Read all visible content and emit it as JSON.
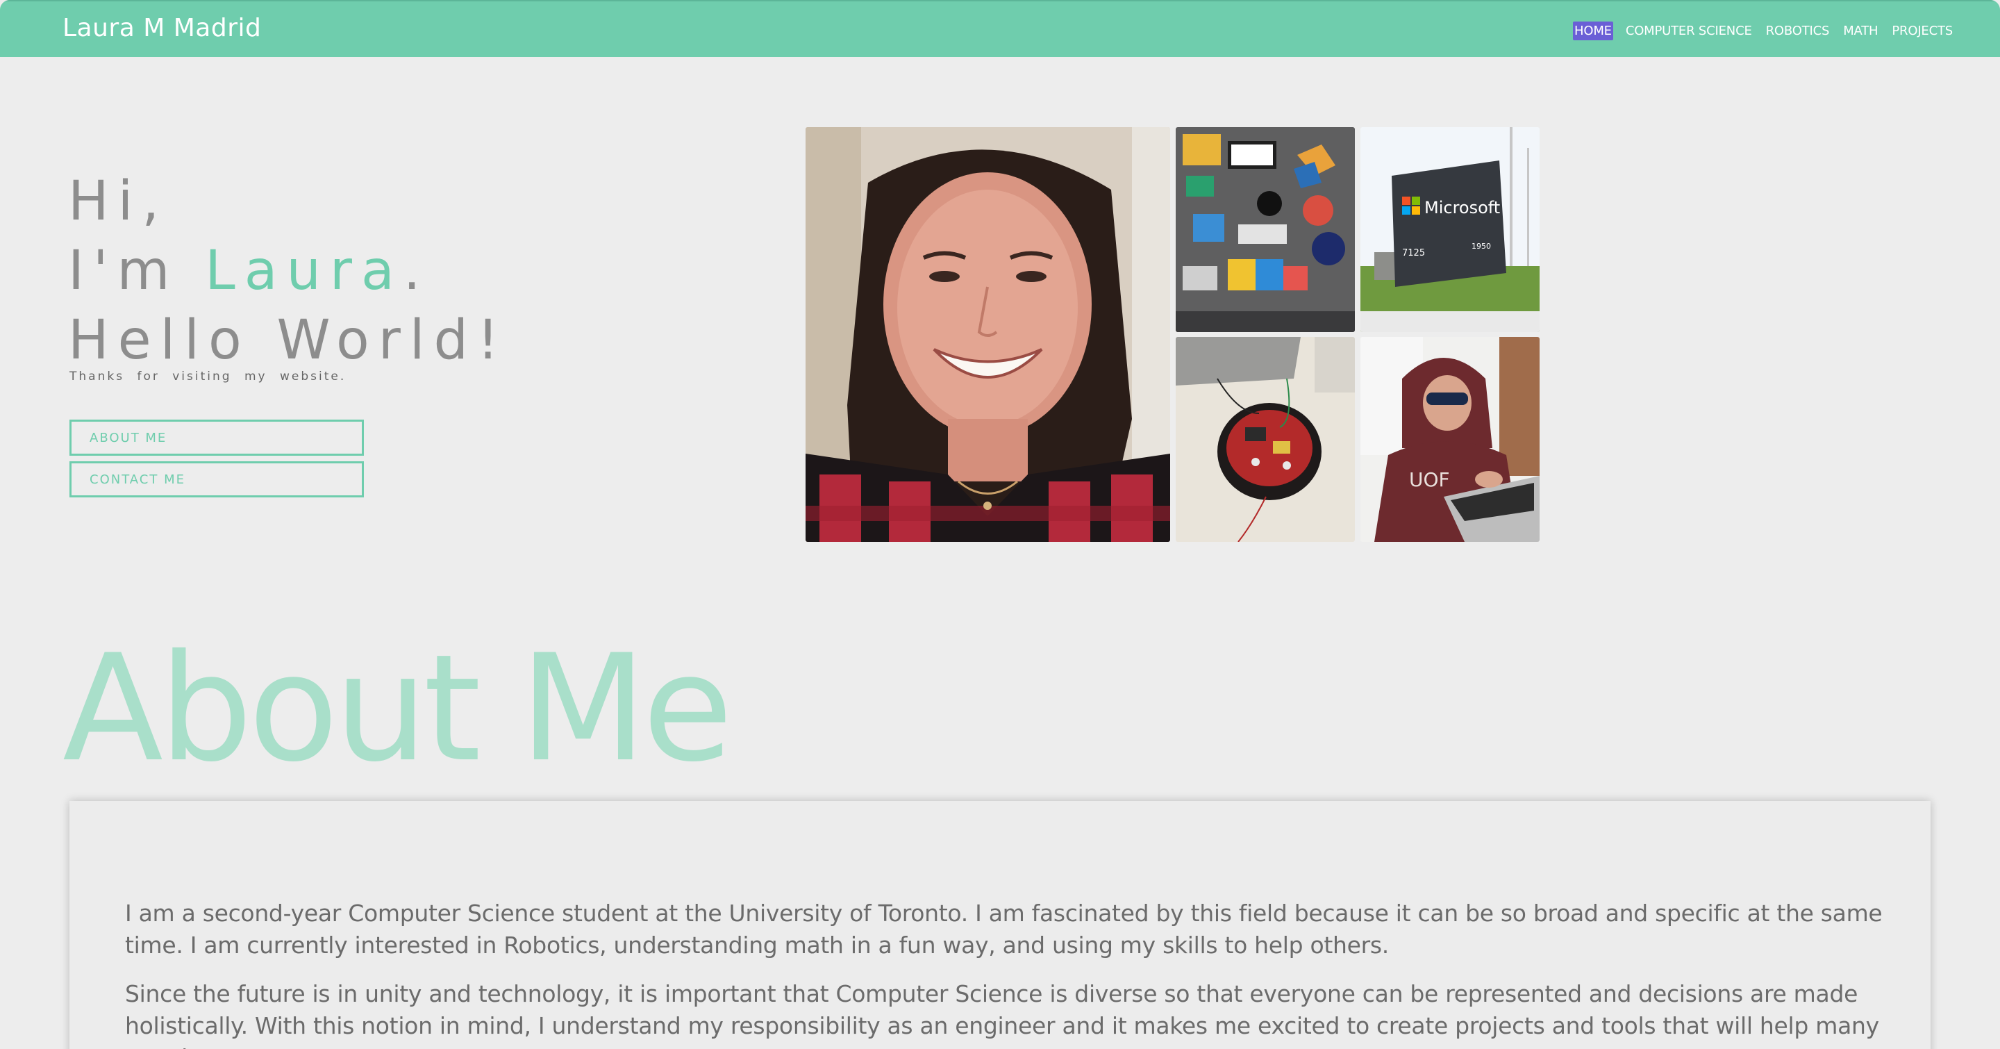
{
  "navbar": {
    "brand": "Laura M Madrid",
    "links": [
      {
        "label": "HOME",
        "active": true
      },
      {
        "label": "COMPUTER SCIENCE",
        "active": false
      },
      {
        "label": "ROBOTICS",
        "active": false
      },
      {
        "label": "MATH",
        "active": false
      },
      {
        "label": "PROJECTS",
        "active": false
      }
    ]
  },
  "hero": {
    "line1": "Hi,",
    "line2_prefix": "I'm ",
    "line2_name": "Laura",
    "line2_suffix": ".",
    "line3": "Hello World!",
    "tagline": "Thanks for visiting my website.",
    "buttons": {
      "about": "ABOUT ME",
      "contact": "CONTACT ME"
    }
  },
  "gallery": {
    "microsoft_sign_text": "Microsoft",
    "microsoft_address_left": "7125",
    "microsoft_address_right": "1950"
  },
  "about": {
    "title": "About Me",
    "paragraphs": [
      "I am a second-year Computer Science student at the University of Toronto. I am fascinated by this field because it can be so broad and specific at the same time. I am currently interested in Robotics, understanding math in a fun way, and using my skills to help others.",
      "Since the future is in unity and technology, it is important that Computer Science is diverse so that everyone can be represented and decisions are made holistically. With this notion in mind, I understand my responsibility as an engineer and it makes me excited to create projects and tools that will help many people!"
    ]
  },
  "colors": {
    "accent": "#6fcdad",
    "nav_active": "#6a5fd6",
    "background": "#ededed",
    "heading_gray": "#8d8d8d",
    "about_title": "#a9dfca"
  }
}
